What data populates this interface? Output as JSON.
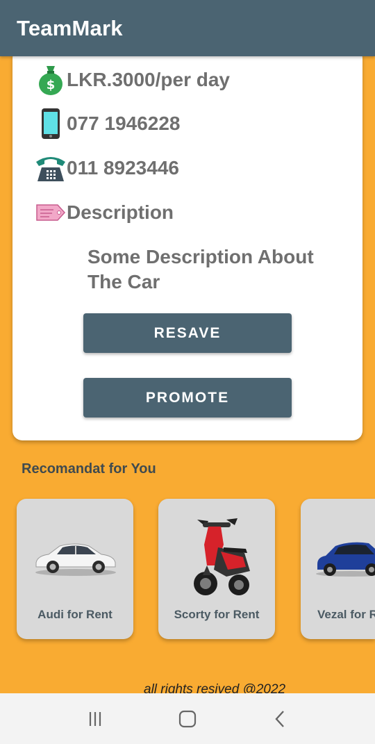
{
  "app": {
    "title": "TeamMark"
  },
  "details": {
    "price": "LKR.3000/per day",
    "mobile": "077 1946228",
    "landline": "011 8923446",
    "description_label": "Description",
    "description_text": "Some Description About The Car"
  },
  "actions": {
    "reserve_label": "RESAVE",
    "promote_label": "PROMOTE"
  },
  "recommended": {
    "title": "Recomandat for You",
    "items": [
      {
        "label": "Audi for Rent",
        "icon": "white-sedan-image"
      },
      {
        "label": "Scorty for Rent",
        "icon": "red-scooter-image"
      },
      {
        "label": "Vezal for Rent",
        "icon": "blue-suv-image"
      }
    ]
  },
  "footer": {
    "text": "all rights resived @2022"
  },
  "nav": {
    "recents": "recents-icon",
    "home": "home-icon",
    "back": "back-icon"
  },
  "colors": {
    "primary": "#4b6472",
    "background": "#f9ab32",
    "card": "#ffffff"
  }
}
